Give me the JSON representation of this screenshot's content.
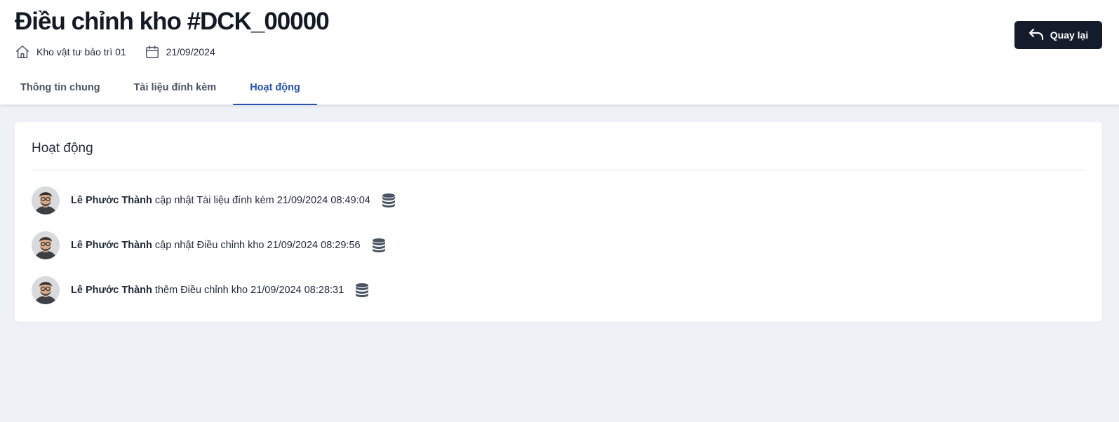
{
  "header": {
    "title": "Điều chỉnh kho #DCK_00000",
    "warehouse": "Kho vật tư bảo trì 01",
    "date": "21/09/2024",
    "back_label": "Quay lại"
  },
  "tabs": [
    {
      "label": "Thông tin chung",
      "active": false
    },
    {
      "label": "Tài liệu đính kèm",
      "active": false
    },
    {
      "label": "Hoạt động",
      "active": true
    }
  ],
  "activity": {
    "title": "Hoạt động",
    "items": [
      {
        "actor": "Lê Phước Thành",
        "action": "cập nhật",
        "target": "Tài liệu đính kèm",
        "timestamp": "21/09/2024 08:49:04"
      },
      {
        "actor": "Lê Phước Thành",
        "action": "cập nhật",
        "target": "Điều chỉnh kho",
        "timestamp": "21/09/2024 08:29:56"
      },
      {
        "actor": "Lê Phước Thành",
        "action": "thêm",
        "target": "Điều chỉnh kho",
        "timestamp": "21/09/2024 08:28:31"
      }
    ]
  },
  "icons": {
    "warehouse": "home-icon",
    "date": "calendar-icon",
    "back": "undo-arrow-icon",
    "activity": "database-icon",
    "avatar": "user-avatar"
  },
  "colors": {
    "accent": "#2453b3",
    "button_bg": "#141c2b",
    "page_bg": "#eef1f6"
  }
}
